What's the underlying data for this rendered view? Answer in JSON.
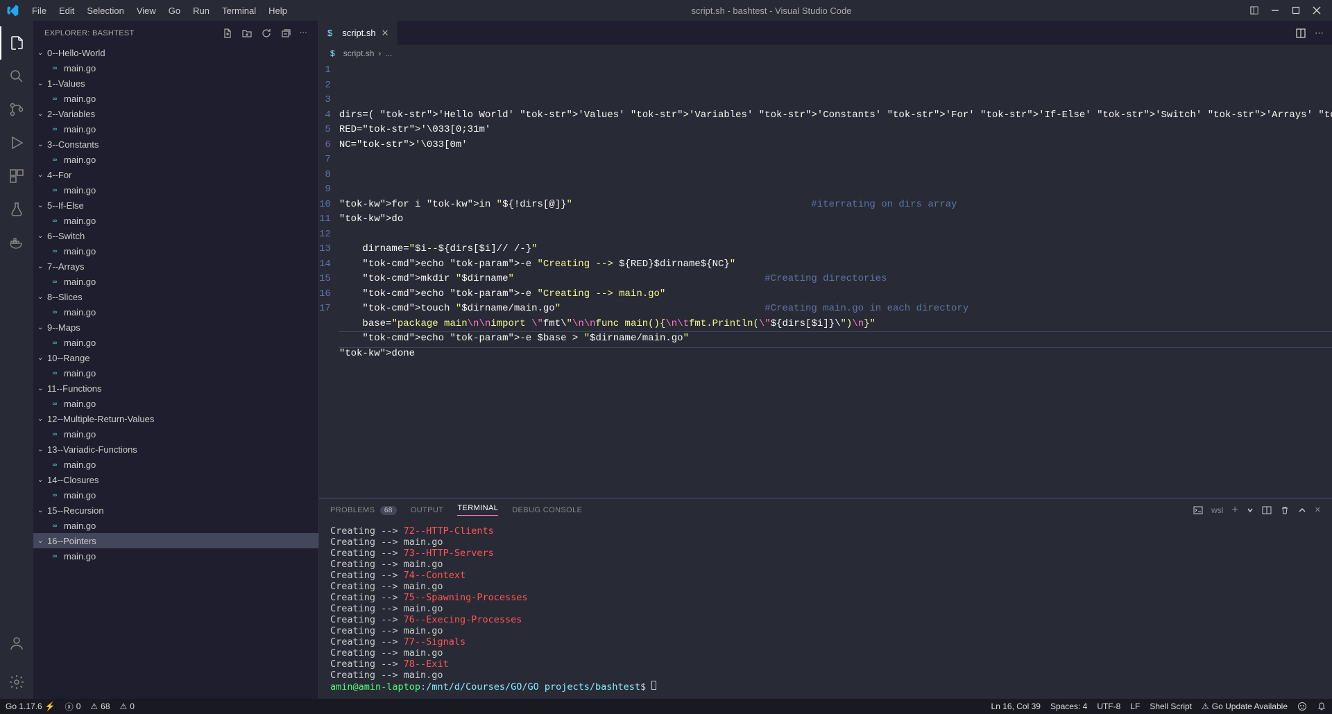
{
  "window": {
    "title": "script.sh - bashtest - Visual Studio Code"
  },
  "menu": [
    "File",
    "Edit",
    "Selection",
    "View",
    "Go",
    "Run",
    "Terminal",
    "Help"
  ],
  "explorer": {
    "header": "EXPLORER: BASHTEST",
    "folders": [
      {
        "name": "0--Hello-World",
        "file": "main.go"
      },
      {
        "name": "1--Values",
        "file": "main.go"
      },
      {
        "name": "2--Variables",
        "file": "main.go"
      },
      {
        "name": "3--Constants",
        "file": "main.go"
      },
      {
        "name": "4--For",
        "file": "main.go"
      },
      {
        "name": "5--If-Else",
        "file": "main.go"
      },
      {
        "name": "6--Switch",
        "file": "main.go"
      },
      {
        "name": "7--Arrays",
        "file": "main.go",
        "selected": true
      },
      {
        "name": "8--Slices",
        "file": "main.go"
      },
      {
        "name": "9--Maps",
        "file": "main.go"
      },
      {
        "name": "10--Range",
        "file": "main.go"
      },
      {
        "name": "11--Functions",
        "file": "main.go"
      },
      {
        "name": "12--Multiple-Return-Values",
        "file": "main.go"
      },
      {
        "name": "13--Variadic-Functions",
        "file": "main.go"
      },
      {
        "name": "14--Closures",
        "file": "main.go"
      },
      {
        "name": "15--Recursion",
        "file": "main.go"
      },
      {
        "name": "16--Pointers",
        "file": "main.go",
        "folderSelected": true
      }
    ]
  },
  "tab": {
    "filename": "script.sh",
    "breadcrumb": "script.sh",
    "breadcrumbSuffix": "..."
  },
  "code": {
    "lines": [
      "dirs=( 'Hello World' 'Values' 'Variables' 'Constants' 'For' 'If-Else' 'Switch' 'Arrays' 'Slices' 'Map",
      "RED='\\033[0;31m'",
      "NC='\\033[0m'",
      "",
      "",
      "",
      "for i in \"${!dirs[@]}\"                                         #iterrating on dirs array",
      "do",
      "",
      "    dirname=\"$i--${dirs[$i]// /-}\"",
      "    echo -e \"Creating --> ${RED}$dirname${NC}\"",
      "    mkdir \"$dirname\"                                           #Creating directories",
      "    echo -e \"Creating --> main.go\"",
      "    touch \"$dirname/main.go\"                                   #Creating main.go in each directory",
      "    base=\"package main\\n\\nimport \\\"fmt\\\"\\n\\nfunc main(){\\n\\tfmt.Println(\\\"${dirs[$i]}\\\")\\n}\"",
      "    echo -e $base > \"$dirname/main.go\"",
      "done"
    ],
    "currentLine": 16
  },
  "panel": {
    "tabs": {
      "problems": "PROBLEMS",
      "problemsBadge": "68",
      "output": "OUTPUT",
      "terminal": "TERMINAL",
      "debug": "DEBUG CONSOLE"
    },
    "terminalType": "wsl",
    "terminal": [
      {
        "prefix": "Creating --> ",
        "red": "72--HTTP-Clients"
      },
      {
        "prefix": "Creating --> main.go"
      },
      {
        "prefix": "Creating --> ",
        "red": "73--HTTP-Servers"
      },
      {
        "prefix": "Creating --> main.go"
      },
      {
        "prefix": "Creating --> ",
        "red": "74--Context"
      },
      {
        "prefix": "Creating --> main.go"
      },
      {
        "prefix": "Creating --> ",
        "red": "75--Spawning-Processes"
      },
      {
        "prefix": "Creating --> main.go"
      },
      {
        "prefix": "Creating --> ",
        "red": "76--Execing-Processes"
      },
      {
        "prefix": "Creating --> main.go"
      },
      {
        "prefix": "Creating --> ",
        "red": "77--Signals"
      },
      {
        "prefix": "Creating --> main.go"
      },
      {
        "prefix": "Creating --> ",
        "red": "78--Exit"
      },
      {
        "prefix": "Creating --> main.go"
      }
    ],
    "prompt": {
      "user": "amin@amin-laptop",
      "sep": ":",
      "path": "/mnt/d/Courses/GO/GO projects/bashtest",
      "suffix": "$"
    }
  },
  "status": {
    "go": "Go 1.17.6",
    "errors": "0",
    "warnings": "68",
    "diag": "0",
    "ln": "Ln 16, Col 39",
    "spaces": "Spaces: 4",
    "encoding": "UTF-8",
    "eol": "LF",
    "lang": "Shell Script",
    "update": "Go Update Available"
  }
}
